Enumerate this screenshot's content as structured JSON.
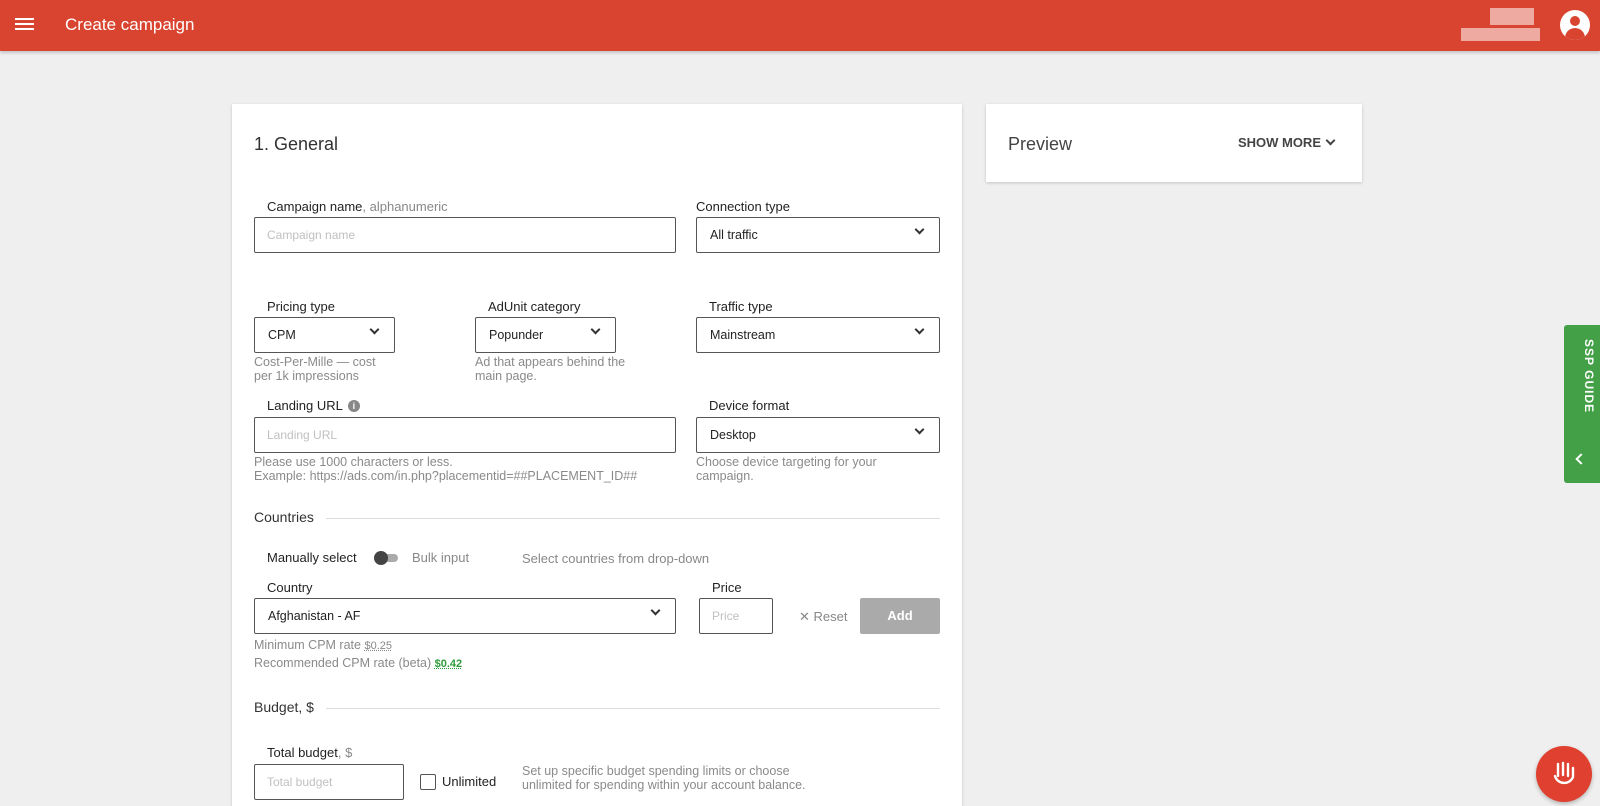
{
  "app": {
    "title": "Create campaign"
  },
  "general": {
    "section_title": "1. General",
    "campaign_name": {
      "label": "Campaign name",
      "hint": "alphanumeric",
      "placeholder": "Campaign name"
    },
    "connection_type": {
      "label": "Connection type",
      "value": "All traffic"
    },
    "pricing_type": {
      "label": "Pricing type",
      "value": "CPM",
      "help": "Cost-Per-Mille — cost per 1k impressions"
    },
    "adunit_category": {
      "label": "AdUnit category",
      "value": "Popunder",
      "help": "Ad that appears behind the main page."
    },
    "traffic_type": {
      "label": "Traffic type",
      "value": "Mainstream"
    },
    "landing_url": {
      "label": "Landing URL",
      "placeholder": "Landing URL",
      "help_line1": "Please use 1000 characters or less.",
      "help_line2": "Example: https://ads.com/in.php?placementid=##PLACEMENT_ID##"
    },
    "device_format": {
      "label": "Device format",
      "value": "Desktop",
      "help": "Choose device targeting for your campaign."
    }
  },
  "countries": {
    "section_title": "Countries",
    "manual_label": "Manually select",
    "bulk_label": "Bulk input",
    "hint": "Select countries from drop-down",
    "country_label": "Country",
    "country_value": "Afghanistan - AF",
    "price_label": "Price",
    "price_placeholder": "Price",
    "reset_label": "Reset",
    "add_label": "Add",
    "min_rate_label": "Minimum CPM rate",
    "min_rate_value": "$0.25",
    "rec_rate_label": "Recommended CPM rate (beta)",
    "rec_rate_value": "$0.42"
  },
  "budget": {
    "section_title": "Budget, $",
    "total_label": "Total budget",
    "total_unit": ", $",
    "total_placeholder": "Total budget",
    "unlimited_label": "Unlimited",
    "help": "Set up specific budget spending limits or choose unlimited for spending within your account balance."
  },
  "preview": {
    "title": "Preview",
    "show_more": "SHOW MORE"
  },
  "side_tab": {
    "label": "SSP GUIDE"
  },
  "icons": {
    "menu": "menu-icon",
    "account": "account-circle-icon",
    "info": "info-icon",
    "chat": "chat-hand-icon"
  }
}
